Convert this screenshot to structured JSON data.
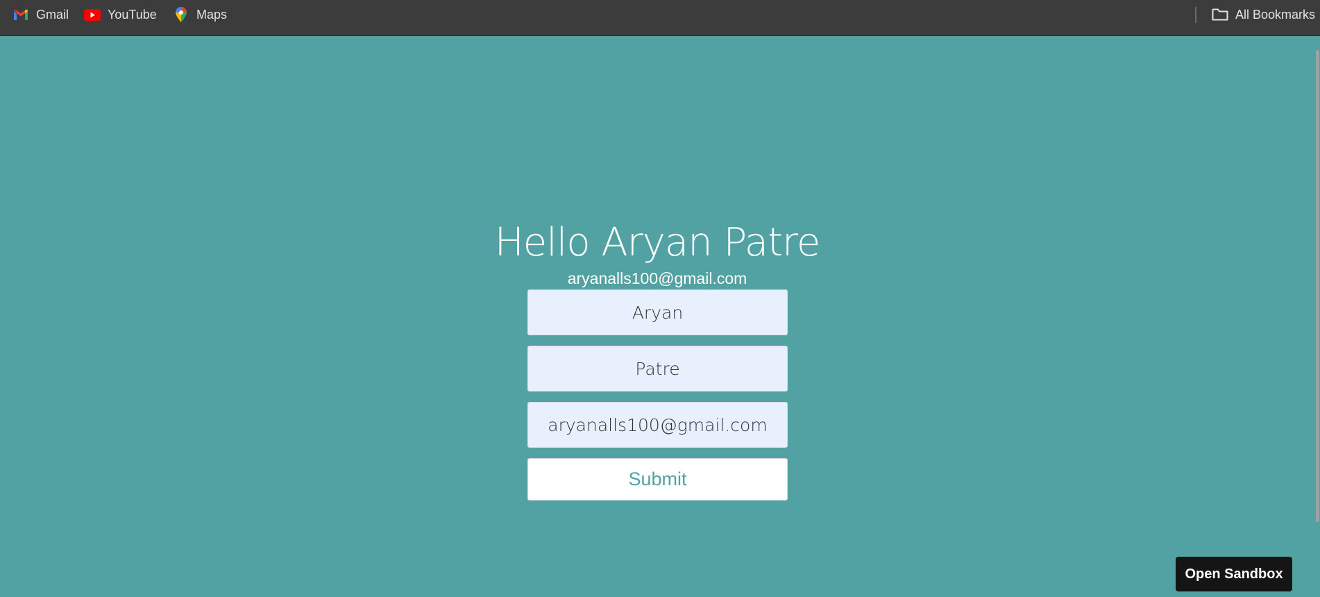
{
  "bookmarks_bar": {
    "items": [
      {
        "label": "Gmail",
        "icon": "gmail-icon"
      },
      {
        "label": "YouTube",
        "icon": "youtube-icon"
      },
      {
        "label": "Maps",
        "icon": "maps-icon"
      }
    ],
    "all_bookmarks": {
      "label": "All Bookmarks",
      "icon": "folder-icon"
    }
  },
  "page": {
    "greeting": "Hello Aryan Patre",
    "email": "aryanalls100@gmail.com",
    "background_color": "#52a2a3"
  },
  "form": {
    "first_name": "Aryan",
    "last_name": "Patre",
    "email": "aryanalls100@gmail.com",
    "submit_label": "Submit"
  },
  "sandbox": {
    "button_label": "Open Sandbox"
  }
}
